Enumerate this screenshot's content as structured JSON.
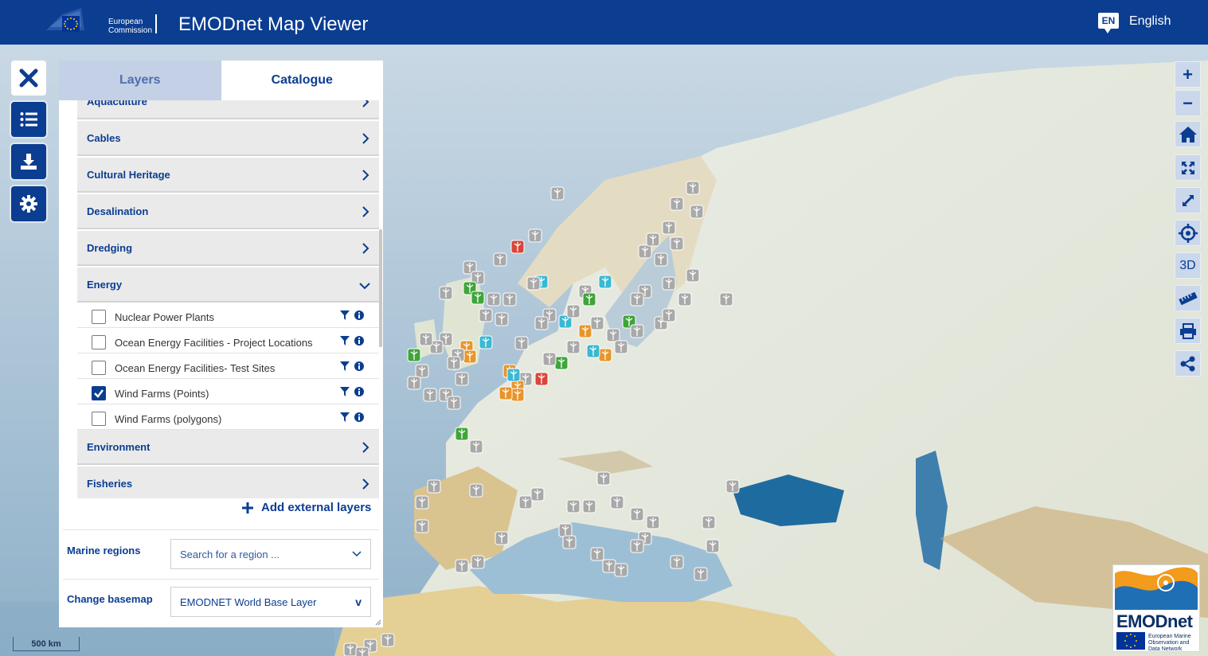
{
  "header": {
    "app_title": "EMODnet Map Viewer",
    "ec_logo_line1": "European",
    "ec_logo_line2": "Commission",
    "lang_code": "EN",
    "lang_label": "English"
  },
  "toolbar": {
    "buttons": [
      {
        "name": "close-icon"
      },
      {
        "name": "list-icon"
      },
      {
        "name": "download-icon"
      },
      {
        "name": "gear-icon"
      }
    ]
  },
  "panel": {
    "tabs": [
      {
        "label": "Layers",
        "active": false
      },
      {
        "label": "Catalogue",
        "active": true
      }
    ],
    "categories_top": [
      "Aquaculture",
      "Cables",
      "Cultural Heritage",
      "Desalination",
      "Dredging"
    ],
    "expanded_category": "Energy",
    "energy_layers": [
      {
        "label": "Nuclear Power Plants",
        "checked": false
      },
      {
        "label": "Ocean Energy Facilities - Project Locations",
        "checked": false
      },
      {
        "label": "Ocean Energy Facilities- Test Sites",
        "checked": false
      },
      {
        "label": "Wind Farms (Points)",
        "checked": true
      },
      {
        "label": "Wind Farms (polygons)",
        "checked": false
      }
    ],
    "categories_bottom": [
      "Environment",
      "Fisheries"
    ],
    "add_external_layers": "Add external layers",
    "marine_regions_label": "Marine regions",
    "marine_regions_placeholder": "Search for a region ...",
    "basemap_label": "Change basemap",
    "basemap_value": "EMODNET World Base Layer",
    "basemap_arrow": "v"
  },
  "map_controls": {
    "zoom_in": "+",
    "zoom_out": "−",
    "three_d": "3D",
    "icons": [
      "home-icon",
      "zoom-extent-icon",
      "fullscreen-icon",
      "locate-icon",
      "ruler-icon",
      "print-icon",
      "share-icon"
    ]
  },
  "scale_bar": "500 km",
  "emodnet_logo": {
    "word": "EMODnet",
    "sub_line1": "European Marine",
    "sub_line2": "Observation and",
    "sub_line3": "Data Network"
  },
  "colors": {
    "brand_blue": "#0b3d91",
    "tab_inactive": "#c3d0e6",
    "category_bg": "#eaeaea",
    "marker_grey": "#a9a9a9",
    "marker_red": "#d9463a",
    "marker_orange": "#e8952b",
    "marker_green": "#3fa53a",
    "marker_cyan": "#3bb8d3"
  }
}
